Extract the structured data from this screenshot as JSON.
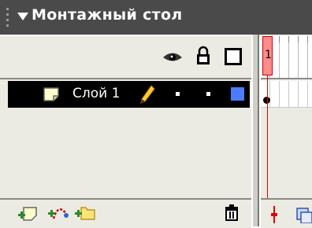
{
  "panel": {
    "title": "Монтажный стол"
  },
  "header": {
    "icons": [
      "eye-icon",
      "lock-icon",
      "outline-icon"
    ]
  },
  "ruler": {
    "current_frame": "1"
  },
  "layers": [
    {
      "name": "Слой 1",
      "selected": true,
      "outline_color": "#4c7dff",
      "visible_marker": "•",
      "lock_marker": "•"
    }
  ],
  "bottom_toolbar": {
    "buttons": [
      "add-layer-icon",
      "add-guide-layer-icon",
      "add-folder-icon",
      "trash-icon"
    ]
  },
  "colors": {
    "titlebar": "#4a4a4a",
    "panel_bg": "#ecebe3",
    "playhead": "#e00000",
    "selected_row": "#000000"
  }
}
